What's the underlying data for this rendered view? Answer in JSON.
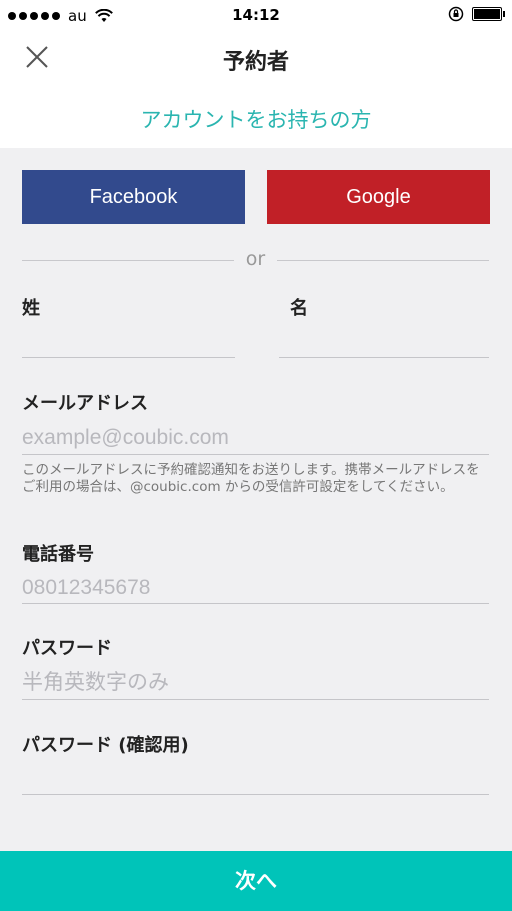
{
  "status_bar": {
    "carrier": "au",
    "time": "14:12"
  },
  "nav": {
    "title": "予約者",
    "account_link": "アカウントをお持ちの方"
  },
  "social": {
    "facebook_label": "Facebook",
    "google_label": "Google",
    "or_label": "or"
  },
  "form": {
    "last_name_label": "姓",
    "first_name_label": "名",
    "email_label": "メールアドレス",
    "email_placeholder": "example@coubic.com",
    "email_note": "このメールアドレスに予約確認通知をお送りします。携帯メールアドレスをご利用の場合は、@coubic.com からの受信許可設定をしてください。",
    "phone_label": "電話番号",
    "phone_placeholder": "08012345678",
    "password_label": "パスワード",
    "password_placeholder": "半角英数字のみ",
    "password_confirm_label": "パスワード (確認用)"
  },
  "footer": {
    "next_label": "次へ"
  },
  "colors": {
    "accent": "#00c4b9",
    "link": "#2ab5b0",
    "facebook": "#324a8d",
    "google": "#c12027"
  }
}
